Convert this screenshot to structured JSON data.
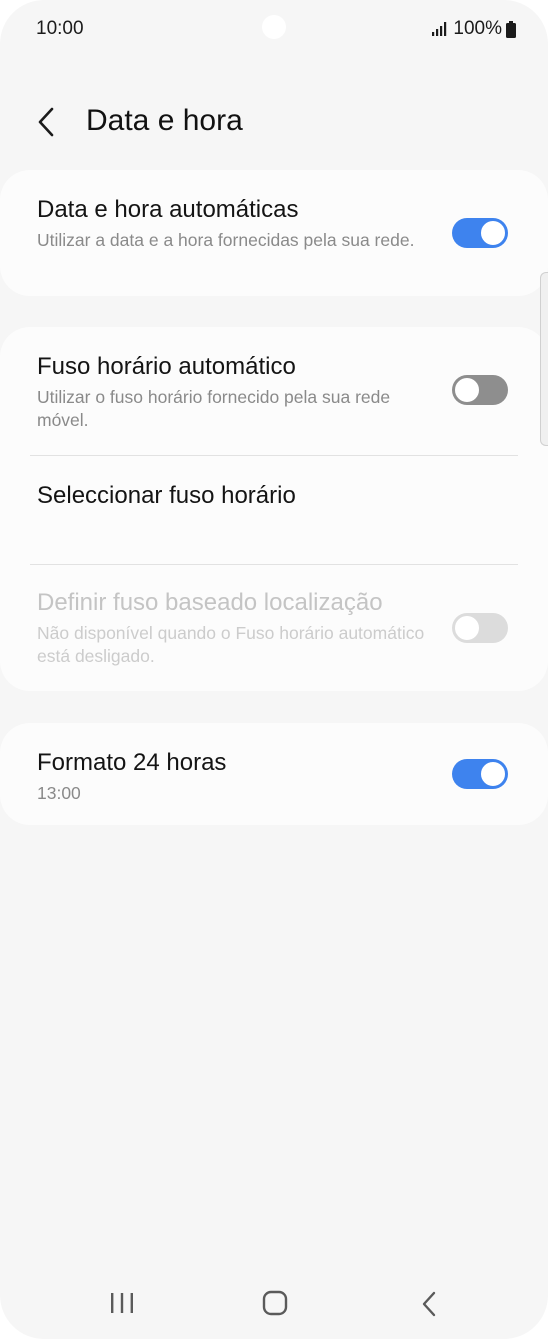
{
  "status_bar": {
    "time": "10:00",
    "battery": "100%",
    "icons": [
      "signal-icon",
      "battery-icon"
    ]
  },
  "header": {
    "title": "Data e hora",
    "back_icon": "back-arrow-icon"
  },
  "settings": {
    "auto_datetime": {
      "title": "Data e hora automáticas",
      "subtitle": "Utilizar a data e a hora fornecidas pela sua rede.",
      "enabled": true
    },
    "auto_timezone": {
      "title": "Fuso horário automático",
      "subtitle": "Utilizar o fuso horário fornecido pela sua rede móvel.",
      "enabled": false
    },
    "select_timezone": {
      "title": "Seleccionar fuso horário"
    },
    "location_timezone": {
      "title": "Definir fuso baseado localização",
      "subtitle": "Não disponível quando o Fuso horário automático está desligado.",
      "enabled": false,
      "disabled": true
    },
    "format_24h": {
      "title": "Formato 24 horas",
      "subtitle": "13:00",
      "enabled": true
    }
  },
  "nav_bar": {
    "icons": [
      "recent-apps-icon",
      "home-icon",
      "back-icon"
    ]
  },
  "colors": {
    "accent": "#3e83ee",
    "background": "#f6f6f6",
    "card": "#fcfcfc"
  }
}
